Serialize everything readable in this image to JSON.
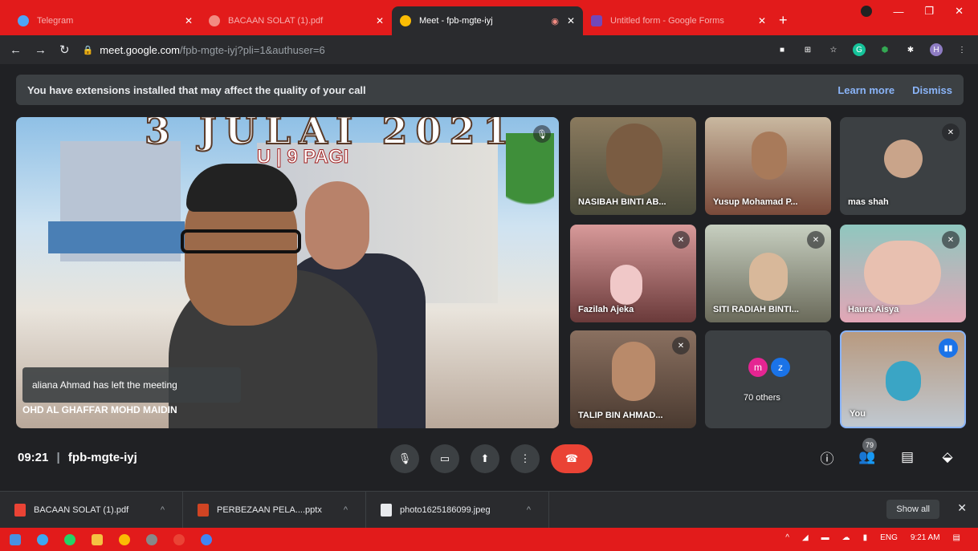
{
  "browser": {
    "tabs": [
      {
        "title": "Telegram",
        "active": false,
        "color": "#4ea4f6"
      },
      {
        "title": "BACAAN SOLAT (1).pdf",
        "active": false,
        "color": "#f28b82"
      },
      {
        "title": "Meet - fpb-mgte-iyj",
        "active": true,
        "color": "#fbbc04"
      },
      {
        "title": "Untitled form - Google Forms",
        "active": false,
        "color": "#7248b9"
      }
    ],
    "url_host": "meet.google.com",
    "url_path": "/fpb-mgte-iyj?pli=1&authuser=6"
  },
  "notice": {
    "message": "You have extensions installed that may affect the quality of your call",
    "learn_more": "Learn more",
    "dismiss": "Dismiss"
  },
  "main_video": {
    "banner_line1": "3 JULAI 2021",
    "banner_line2": "U | 9 PAGI",
    "toast": "aliana Ahmad has left the meeting",
    "speaker_name": "OHD AL GHAFFAR MOHD MAIDIN"
  },
  "participants": [
    {
      "name": "NASIBAH BINTI AB...",
      "muted": false
    },
    {
      "name": "Yusup Mohamad P...",
      "muted": false
    },
    {
      "name": "mas shah",
      "muted": true
    },
    {
      "name": "Fazilah Ajeka",
      "muted": true
    },
    {
      "name": "SITI RADIAH BINTI...",
      "muted": true
    },
    {
      "name": "Haura Aisya",
      "muted": true
    },
    {
      "name": "TALIP BIN AHMAD...",
      "muted": true
    },
    {
      "name": "70 others",
      "initials": [
        "m",
        "z"
      ]
    },
    {
      "name": "You",
      "speaking": true
    }
  ],
  "bottom": {
    "time": "09:21",
    "meeting_code": "fpb-mgte-iyj",
    "participant_count": "79"
  },
  "downloads": [
    {
      "name": "BACAAN SOLAT (1).pdf"
    },
    {
      "name": "PERBEZAAN PELA....pptx"
    },
    {
      "name": "photo1625186099.jpeg"
    }
  ],
  "downloads_show_all": "Show all",
  "taskbar": {
    "lang": "ENG",
    "clock": "9:21 AM"
  },
  "colors": {
    "accent": "#8ab4f8",
    "end_call": "#ea4335",
    "chrome_frame": "#e21b1b"
  }
}
